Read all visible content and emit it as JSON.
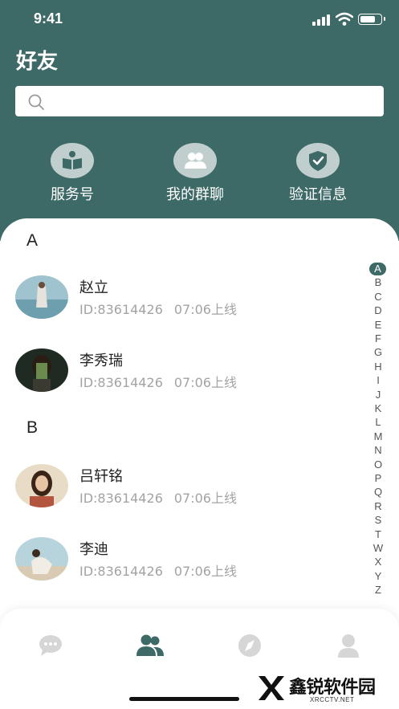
{
  "status_bar": {
    "time": "9:41",
    "battery_level": 0.8
  },
  "header": {
    "title": "好友",
    "search": {
      "placeholder": "",
      "value": ""
    },
    "quick_actions": [
      {
        "label": "服务号",
        "icon": "book-icon"
      },
      {
        "label": "我的群聊",
        "icon": "group-icon"
      },
      {
        "label": "验证信息",
        "icon": "shield-check-icon"
      }
    ]
  },
  "sections": [
    {
      "letter": "A",
      "contacts": [
        {
          "name": "赵立",
          "id": "ID:83614426",
          "time": "07:06上线"
        },
        {
          "name": "李秀瑞",
          "id": "ID:83614426",
          "time": "07:06上线"
        }
      ]
    },
    {
      "letter": "B",
      "contacts": [
        {
          "name": "吕轩铭",
          "id": "ID:83614426",
          "time": "07:06上线"
        },
        {
          "name": "李迪",
          "id": "ID:83614426",
          "time": "07:06上线"
        }
      ]
    }
  ],
  "alphabet_index": {
    "letters": [
      "A",
      "B",
      "C",
      "D",
      "E",
      "F",
      "G",
      "H",
      "I",
      "J",
      "K",
      "L",
      "M",
      "N",
      "O",
      "P",
      "Q",
      "R",
      "S",
      "T",
      "W",
      "X",
      "Y",
      "Z"
    ],
    "active": "A"
  },
  "tab_bar": {
    "tabs": [
      {
        "icon": "chat-bubble-icon",
        "active": false
      },
      {
        "icon": "contacts-icon",
        "active": true
      },
      {
        "icon": "compass-icon",
        "active": false
      },
      {
        "icon": "profile-icon",
        "active": false
      }
    ]
  },
  "watermark": {
    "title": "鑫锐软件园",
    "subtitle": "XRCCTV.NET"
  },
  "colors": {
    "primary": "#3d6966",
    "inactive_icon": "#d6d6d6",
    "secondary_text": "#a3a3a3"
  }
}
